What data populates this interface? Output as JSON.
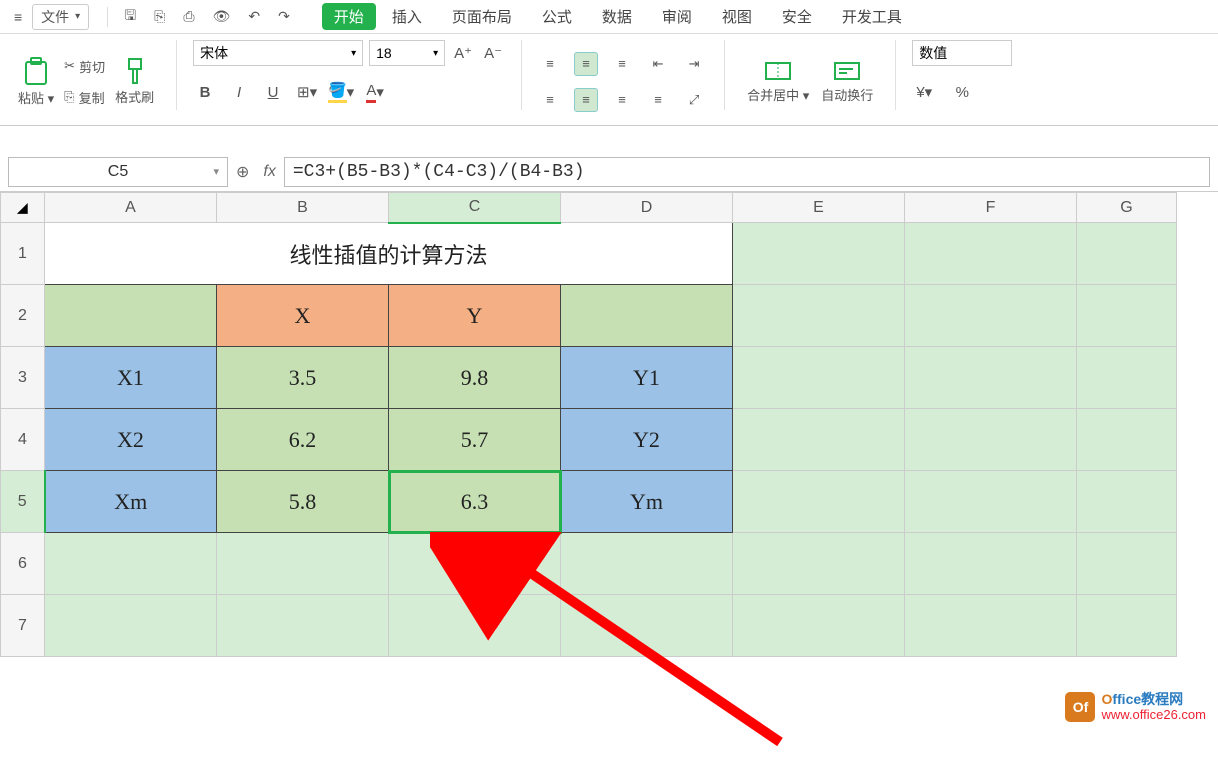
{
  "menu": {
    "file": "文件",
    "tabs": {
      "start": "开始",
      "insert": "插入",
      "layout": "页面布局",
      "formula": "公式",
      "data": "数据",
      "review": "审阅",
      "view": "视图",
      "security": "安全",
      "dev": "开发工具"
    }
  },
  "ribbon": {
    "paste": "粘贴",
    "cut": "剪切",
    "copy": "复制",
    "formatPainter": "格式刷",
    "font_name": "宋体",
    "font_size": "18",
    "merge": "合并居中",
    "wrap": "自动换行",
    "number_format": "数值"
  },
  "namebox": "C5",
  "formula": "=C3+(B5-B3)*(C4-C3)/(B4-B3)",
  "columns": [
    "A",
    "B",
    "C",
    "D",
    "E",
    "F",
    "G"
  ],
  "rows": [
    "1",
    "2",
    "3",
    "4",
    "5",
    "6",
    "7"
  ],
  "cells": {
    "title": "线性插值的计算方法",
    "B2": "X",
    "C2": "Y",
    "A3": "X1",
    "B3": "3.5",
    "C3": "9.8",
    "D3": "Y1",
    "A4": "X2",
    "B4": "6.2",
    "C4": "5.7",
    "D4": "Y2",
    "A5": "Xm",
    "B5": "5.8",
    "C5": "6.3",
    "D5": "Ym"
  },
  "watermark": {
    "title_prefix": "O",
    "title_rest": "ffice教程网",
    "url": "www.office26.com"
  }
}
